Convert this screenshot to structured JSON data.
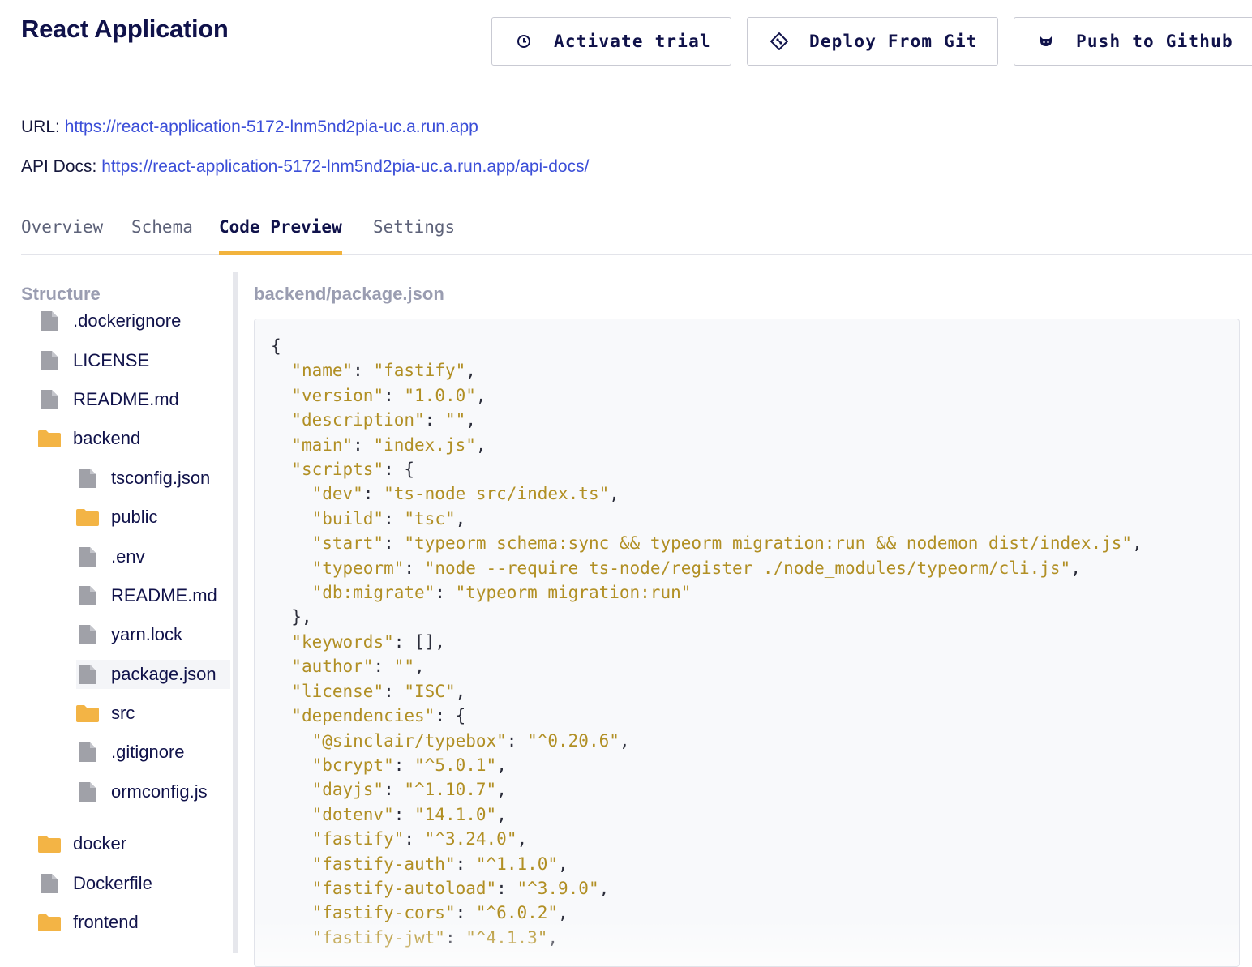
{
  "app": {
    "title": "React Application"
  },
  "actions": {
    "activate_trial": "Activate trial",
    "deploy_from_git": "Deploy From Git",
    "push_to_github": "Push to Github"
  },
  "links": {
    "url_label": "URL:",
    "url": "https://react-application-5172-lnm5nd2pia-uc.a.run.app",
    "api_label": "API Docs:",
    "api_url": "https://react-application-5172-lnm5nd2pia-uc.a.run.app/api-docs/"
  },
  "tabs": [
    {
      "label": "Overview",
      "active": false
    },
    {
      "label": "Schema",
      "active": false
    },
    {
      "label": "Code Preview",
      "active": true
    },
    {
      "label": "Settings",
      "active": false
    }
  ],
  "sidebar": {
    "title": "Structure",
    "items": [
      {
        "name": ".dockerignore",
        "type": "file",
        "level": 0
      },
      {
        "name": "LICENSE",
        "type": "file",
        "level": 0
      },
      {
        "name": "README.md",
        "type": "file",
        "level": 0
      },
      {
        "name": "backend",
        "type": "folder",
        "level": 0
      },
      {
        "name": "tsconfig.json",
        "type": "file",
        "level": 1
      },
      {
        "name": "public",
        "type": "folder",
        "level": 1
      },
      {
        "name": ".env",
        "type": "file",
        "level": 1
      },
      {
        "name": "README.md",
        "type": "file",
        "level": 1
      },
      {
        "name": "yarn.lock",
        "type": "file",
        "level": 1
      },
      {
        "name": "package.json",
        "type": "file",
        "level": 1,
        "selected": true
      },
      {
        "name": "src",
        "type": "folder",
        "level": 1
      },
      {
        "name": ".gitignore",
        "type": "file",
        "level": 1
      },
      {
        "name": "ormconfig.js",
        "type": "file",
        "level": 1
      },
      {
        "name": "docker",
        "type": "folder",
        "level": 0
      },
      {
        "name": "Dockerfile",
        "type": "file",
        "level": 0
      },
      {
        "name": "frontend",
        "type": "folder",
        "level": 0
      }
    ]
  },
  "editor": {
    "file_path": "backend/package.json",
    "lines": [
      "{",
      "  \"name\": \"fastify\",",
      "  \"version\": \"1.0.0\",",
      "  \"description\": \"\",",
      "  \"main\": \"index.js\",",
      "  \"scripts\": {",
      "    \"dev\": \"ts-node src/index.ts\",",
      "    \"build\": \"tsc\",",
      "    \"start\": \"typeorm schema:sync && typeorm migration:run && nodemon dist/index.js\",",
      "    \"typeorm\": \"node --require ts-node/register ./node_modules/typeorm/cli.js\",",
      "    \"db:migrate\": \"typeorm migration:run\"",
      "  },",
      "  \"keywords\": [],",
      "  \"author\": \"\",",
      "  \"license\": \"ISC\",",
      "  \"dependencies\": {",
      "    \"@sinclair/typebox\": \"^0.20.6\",",
      "    \"bcrypt\": \"^5.0.1\",",
      "    \"dayjs\": \"^1.10.7\",",
      "    \"dotenv\": \"14.1.0\",",
      "    \"fastify\": \"^3.24.0\",",
      "    \"fastify-auth\": \"^1.1.0\",",
      "    \"fastify-autoload\": \"^3.9.0\",",
      "    \"fastify-cors\": \"^6.0.2\",",
      "    \"fastify-jwt\": \"^4.1.3\","
    ]
  },
  "colors": {
    "accent_underline": "#f2b33d",
    "link": "#3b4ed8",
    "folder_icon": "#f3b445",
    "file_icon": "#a0a1a8",
    "code_string": "#b18f24"
  }
}
